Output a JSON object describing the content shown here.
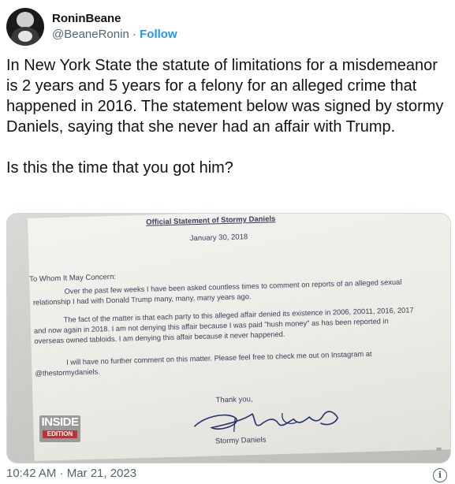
{
  "author": {
    "display_name": "RoninBeane",
    "handle": "@BeaneRonin",
    "separator": "·",
    "follow_label": "Follow",
    "avatar_icon": "profile-avatar"
  },
  "tweet": {
    "text": "In New York State the statute of limitations for a misdemeanor is 2 years and 5 years for a felony for an alleged crime that happened in 2016. The statement below was signed by stormy Daniels, saying that she never had an affair with Trump.\n\nIs this the time that you got him?",
    "timestamp": "10:42 AM · Mar 21, 2023"
  },
  "media": {
    "document": {
      "title": "Official Statement of Stormy Daniels",
      "date": "January 30, 2018",
      "greeting": "To Whom It May Concern:",
      "paragraph1": "Over the past few weeks I have been asked countless times to comment on reports of an alleged sexual relationship I had with Donald Trump many, many, many years ago.",
      "paragraph2": "The fact of the matter is that each party to this alleged affair denied its existence in 2006, 20011, 2016, 2017 and now again in 2018. I am not denying this affair because I was paid \"hush money\" as has been reported in overseas owned tabloids. I am denying this affair because it never happened.",
      "paragraph3": "I will have no further comment on this matter. Please feel free to check me out on Instagram at @thestormydaniels.",
      "closing": "Thank you,",
      "signatory": "Stormy Daniels"
    },
    "watermark": {
      "line1": "INSIDE",
      "line2": "EDITION"
    },
    "corner_mark": "≖"
  },
  "icons": {
    "info": "info-icon"
  },
  "info_glyph": "i"
}
